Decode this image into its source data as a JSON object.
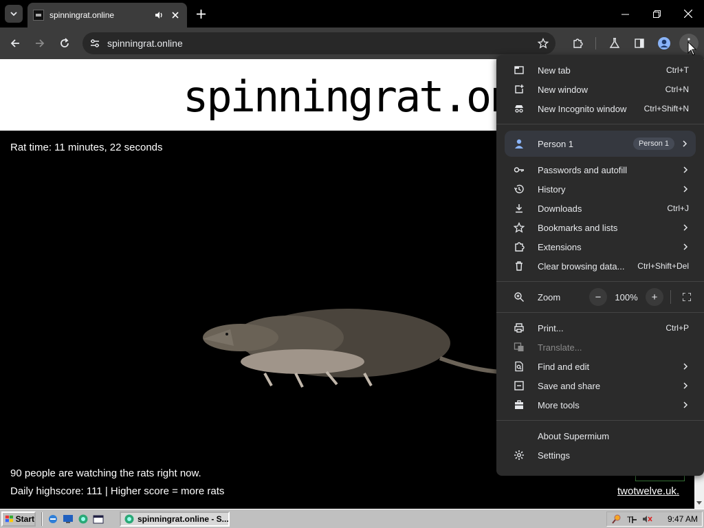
{
  "browser": {
    "tab": {
      "title": "spinningrat.online"
    },
    "omnibox": {
      "url": "spinningrat.online"
    }
  },
  "page": {
    "site_title": "spinningrat.online",
    "rat_time": "Rat time: 11 minutes, 22 seconds",
    "watching": "90 people are watching the rats right now.",
    "highscore": "Daily highscore: 111 | Higher score = more rats",
    "footer_link": "twotwelve.uk."
  },
  "menu": {
    "new_tab": {
      "label": "New tab",
      "shortcut": "Ctrl+T"
    },
    "new_window": {
      "label": "New window",
      "shortcut": "Ctrl+N"
    },
    "new_incognito": {
      "label": "New Incognito window",
      "shortcut": "Ctrl+Shift+N"
    },
    "person": {
      "label": "Person 1",
      "chip": "Person 1"
    },
    "passwords": {
      "label": "Passwords and autofill"
    },
    "history": {
      "label": "History"
    },
    "downloads": {
      "label": "Downloads",
      "shortcut": "Ctrl+J"
    },
    "bookmarks": {
      "label": "Bookmarks and lists"
    },
    "extensions": {
      "label": "Extensions"
    },
    "clear": {
      "label": "Clear browsing data...",
      "shortcut": "Ctrl+Shift+Del"
    },
    "zoom": {
      "label": "Zoom",
      "minus": "−",
      "value": "100%",
      "plus": "+"
    },
    "print": {
      "label": "Print...",
      "shortcut": "Ctrl+P"
    },
    "translate": {
      "label": "Translate..."
    },
    "find": {
      "label": "Find and edit"
    },
    "save": {
      "label": "Save and share"
    },
    "more_tools": {
      "label": "More tools"
    },
    "about": {
      "label": "About Supermium"
    },
    "settings": {
      "label": "Settings"
    }
  },
  "taskbar": {
    "start": "Start",
    "task_label": "spinningrat.online - S...",
    "clock": "9:47 AM"
  },
  "colors": {
    "menu_bg": "#2b2b2b",
    "toolbar_bg": "#3c3c3c",
    "person_highlight": "#35383f",
    "taskbar": "#c0c0c0"
  }
}
